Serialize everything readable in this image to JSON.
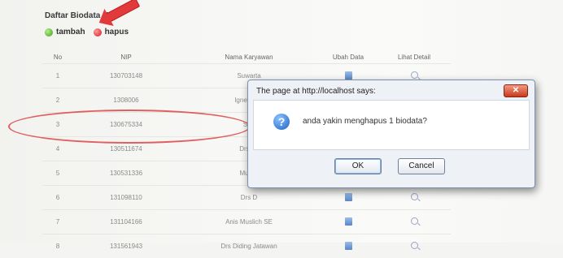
{
  "page": {
    "title": "Daftar Biodata Kar"
  },
  "toolbar": {
    "add_label": "tambah",
    "delete_label": "hapus"
  },
  "table": {
    "headers": [
      "No",
      "NIP",
      "Nama Karyawan",
      "Ubah Data",
      "Lihat Detail"
    ],
    "rows": [
      {
        "no": "1",
        "nip": "130703148",
        "nama": "Suwarta"
      },
      {
        "no": "2",
        "nip": "1308006",
        "nama": "Ignetius P"
      },
      {
        "no": "3",
        "nip": "130675334",
        "nama": "Sub"
      },
      {
        "no": "4",
        "nip": "130511674",
        "nama": "Drs Tu"
      },
      {
        "no": "5",
        "nip": "130531336",
        "nama": "Mustik"
      },
      {
        "no": "6",
        "nip": "131098110",
        "nama": "Drs D"
      },
      {
        "no": "7",
        "nip": "131104166",
        "nama": "Anis Muslich SE"
      },
      {
        "no": "8",
        "nip": "131561943",
        "nama": "Drs Diding Jatawan"
      }
    ]
  },
  "dialog": {
    "title": "The page at http://localhost says:",
    "message": "anda yakin menghapus 1 biodata?",
    "ok_label": "OK",
    "cancel_label": "Cancel"
  },
  "colors": {
    "annotation": "#e06060",
    "dialog_bg": "#eef1f6",
    "close_button": "#c9391c"
  }
}
